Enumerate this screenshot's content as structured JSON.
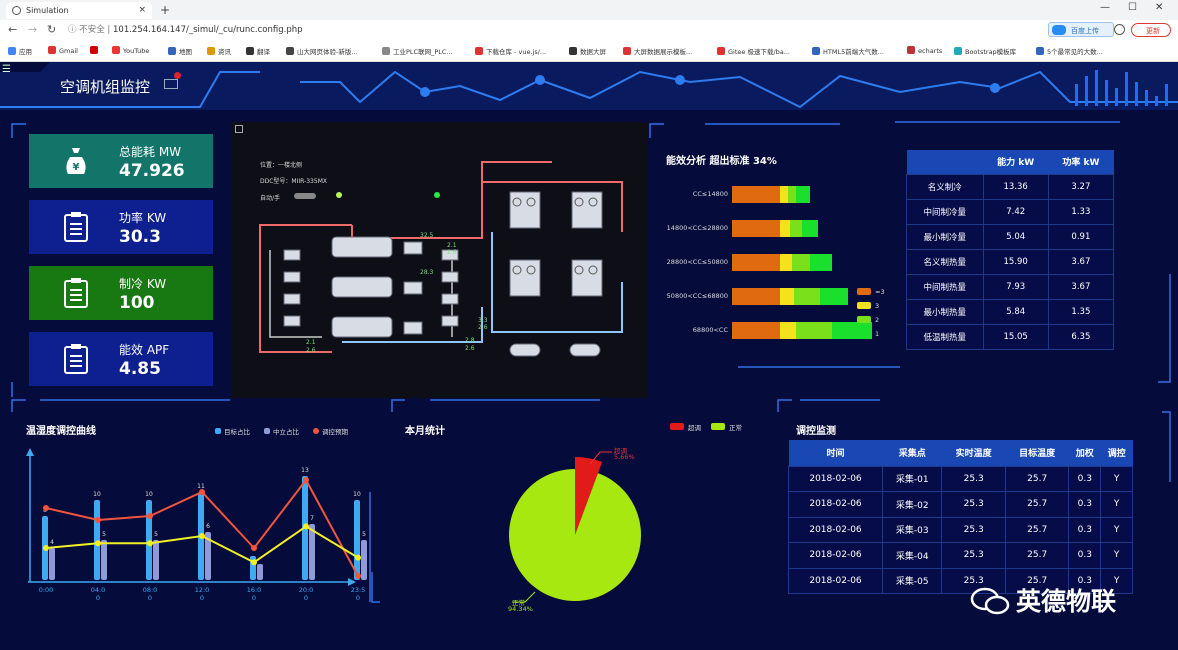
{
  "browser": {
    "tab_title": "Simulation",
    "new_tab": "+",
    "insecure_label": "不安全",
    "url": "101.254.164.147/_simul/_cu/runc.config.php",
    "ext_label": "百度上传",
    "update_label": "更新",
    "win_min": "—",
    "win_max": "☐",
    "win_close": "✕",
    "bookmarks": [
      "应用",
      "Gmail",
      "",
      "YouTube",
      "地图",
      "资讯",
      "翻译",
      "山大网页体验-新版...",
      "工业PLC联网_PLC...",
      "下载仓库 - vue.js/...",
      "数据大屏",
      "大屏数据展示模板...",
      "Gitee 极速下载/ba...",
      "HTML5前端大气数...",
      "echarts",
      "Bootstrap模板库",
      "5个最常见的大数..."
    ]
  },
  "app": {
    "menu_glyph": "☰",
    "title": "空调机组监控",
    "cards": [
      {
        "label": "总能耗 MW",
        "value": "47.926",
        "color": "#13756a",
        "icon": "money-bag-icon"
      },
      {
        "label": "功率 KW",
        "value": "30.3",
        "color": "#0e1f90",
        "icon": "clipboard-icon"
      },
      {
        "label": "制冷 KW",
        "value": "100",
        "color": "#187812",
        "icon": "clipboard-icon"
      },
      {
        "label": "能效 APF",
        "value": "4.85",
        "color": "#0e1f90",
        "icon": "clipboard-icon"
      }
    ],
    "diagram": {
      "line1": "位置：一楼北侧",
      "line2": "DDC型号：MIIR-335MX",
      "line3": "自动/手",
      "labels": [
        "32.5",
        "28.3",
        "2.1",
        "2.6",
        "2.8",
        "2.6",
        "3.3",
        "2.6",
        "2.1",
        "2.6"
      ]
    },
    "efficiency": {
      "title": "能效分析   超出标准 34%",
      "legend": [
        "≈3",
        "3",
        "2",
        "1"
      ],
      "legend_colors": [
        "#e06a10",
        "#f4e21d",
        "#7be01c",
        "#1adf2c"
      ]
    },
    "capacity_table": {
      "headers": [
        "",
        "能力 kW",
        "功率 kW"
      ],
      "rows": [
        [
          "名义制冷",
          "13.36",
          "3.27"
        ],
        [
          "中间制冷量",
          "7.42",
          "1.33"
        ],
        [
          "最小制冷量",
          "5.04",
          "0.91"
        ],
        [
          "名义制热量",
          "15.90",
          "3.67"
        ],
        [
          "中间制热量",
          "7.93",
          "3.67"
        ],
        [
          "最小制热量",
          "5.84",
          "1.35"
        ],
        [
          "低温制热量",
          "15.05",
          "6.35"
        ]
      ]
    },
    "temp_curve": {
      "title": "温湿度调控曲线",
      "legend": [
        "目标占比",
        "中立占比",
        "调控预期"
      ]
    },
    "monthly": {
      "title": "本月统计",
      "legend": [
        "超调",
        "正常"
      ],
      "over_label": "超调",
      "over_pct": "5.66%",
      "normal_label": "正常",
      "normal_pct": "94.34%"
    },
    "monitor": {
      "title": "调控监测",
      "headers": [
        "时间",
        "采集点",
        "实时温度",
        "目标温度",
        "加权",
        "调控"
      ],
      "rows": [
        [
          "2018-02-06",
          "采集-01",
          "25.3",
          "25.7",
          "0.3",
          "Y"
        ],
        [
          "2018-02-06",
          "采集-02",
          "25.3",
          "25.7",
          "0.3",
          "Y"
        ],
        [
          "2018-02-06",
          "采集-03",
          "25.3",
          "25.7",
          "0.3",
          "Y"
        ],
        [
          "2018-02-06",
          "采集-04",
          "25.3",
          "25.7",
          "0.3",
          "Y"
        ],
        [
          "2018-02-06",
          "采集-05",
          "25.3",
          "25.7",
          "0.3",
          "Y"
        ]
      ]
    },
    "watermark": "英德物联"
  },
  "chart_data": [
    {
      "type": "bar",
      "title": "能效分析   超出标准 34%",
      "categories": [
        "CC≤14800",
        "14800<CC≤28800",
        "28800<CC≤50800",
        "50800<CC≤68800",
        "68800<CC"
      ],
      "series": [
        {
          "name": "≈3",
          "values": [
            48,
            48,
            48,
            48,
            48
          ]
        },
        {
          "name": "3",
          "values": [
            8,
            10,
            12,
            14,
            16
          ]
        },
        {
          "name": "2",
          "values": [
            8,
            12,
            18,
            26,
            36
          ]
        },
        {
          "name": "1",
          "values": [
            14,
            16,
            22,
            28,
            40
          ]
        }
      ]
    },
    {
      "type": "bar",
      "title": "温湿度调控曲线",
      "categories": [
        "00:00",
        "04:00",
        "08:00",
        "12:00",
        "16:00",
        "20:00",
        "23:50"
      ],
      "x_tick_labels": [
        [
          "0:00",
          ""
        ],
        [
          "04:0",
          "0"
        ],
        [
          "08:0",
          "0"
        ],
        [
          "12:0",
          "0"
        ],
        [
          "16:0",
          "0"
        ],
        [
          "20:0",
          "0"
        ],
        [
          "23:5",
          "0"
        ]
      ],
      "ylim": [
        0,
        14
      ],
      "series": [
        {
          "name": "目标占比",
          "type": "bar",
          "values": [
            8,
            10,
            10,
            11,
            3,
            13,
            10
          ],
          "labels": [
            "8",
            "10",
            "10",
            "11",
            "",
            "13",
            "10"
          ]
        },
        {
          "name": "中立占比",
          "type": "bar",
          "values": [
            4,
            5,
            5,
            6,
            2,
            7,
            5
          ],
          "labels": [
            "4",
            "5",
            "5",
            "6",
            "",
            "7",
            "5"
          ]
        },
        {
          "name": "调控预期",
          "type": "line",
          "values": [
            9,
            7.5,
            8,
            11,
            4,
            12.5,
            0.5
          ]
        },
        {
          "name": "中立占比-线",
          "type": "line",
          "values": [
            4,
            4.6,
            4.6,
            5.5,
            2.2,
            6.7,
            2.8
          ]
        }
      ]
    },
    {
      "type": "pie",
      "title": "本月统计",
      "labels": [
        "超调",
        "正常"
      ],
      "values": [
        5.66,
        94.34
      ],
      "colors": [
        "#e21a1a",
        "#a7e810"
      ]
    }
  ]
}
